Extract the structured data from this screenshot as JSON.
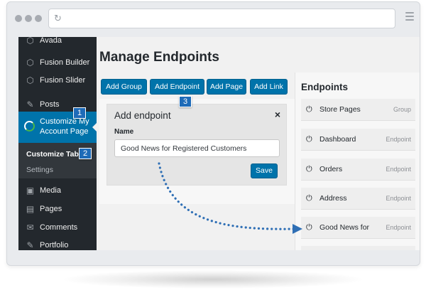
{
  "browser": {
    "window_dot_icons": [
      "window-dot-icon",
      "window-dot-icon",
      "window-dot-icon"
    ],
    "reload_icon": "↻",
    "menu_icon": "hamburger-icon"
  },
  "sidebar": {
    "items": [
      {
        "label": "Avada",
        "icon": "avada-icon",
        "glyph": "⬡"
      },
      {
        "label": "Fusion Builder",
        "icon": "fusion-builder-icon",
        "glyph": "⬡"
      },
      {
        "label": "Fusion Slider",
        "icon": "fusion-slider-icon",
        "glyph": "⬡"
      },
      {
        "label": "Posts",
        "icon": "pin-icon",
        "glyph": "✎"
      }
    ],
    "active": {
      "label": "Customize My Account Page",
      "icon": "customize-icon"
    },
    "submenu": [
      {
        "label": "Customize Tabs",
        "current": true
      },
      {
        "label": "Settings",
        "current": false
      }
    ],
    "lower_items": [
      {
        "label": "Media",
        "icon": "media-icon",
        "glyph": "▣"
      },
      {
        "label": "Pages",
        "icon": "pages-icon",
        "glyph": "▤"
      },
      {
        "label": "Comments",
        "icon": "comments-icon",
        "glyph": "✉"
      },
      {
        "label": "Portfolio",
        "icon": "portfolio-icon",
        "glyph": "✎"
      }
    ],
    "colors": {
      "background": "#23282d",
      "active": "#0073aa",
      "submenu": "#32373c"
    }
  },
  "main": {
    "page_title": "Manage Endpoints",
    "toolbar": {
      "add_group": "Add Group",
      "add_endpoint": "Add Endpoint",
      "add_page": "Add Page",
      "add_link": "Add Link"
    },
    "add_endpoint_form": {
      "title": "Add endpoint",
      "close": "×",
      "name_label": "Name",
      "name_value": "Good News for Registered Customers",
      "save": "Save"
    }
  },
  "endpoints": {
    "title": "Endpoints",
    "items": [
      {
        "name": "Store Pages",
        "type": "Group"
      },
      {
        "name": "Dashboard",
        "type": "Endpoint"
      },
      {
        "name": "Orders",
        "type": "Endpoint"
      },
      {
        "name": "Address",
        "type": "Endpoint"
      },
      {
        "name": "Good News for",
        "type": "Endpoint"
      }
    ],
    "power_glyph": "⏻"
  },
  "callouts": {
    "step_1": "1",
    "step_2": "2",
    "step_3": "3"
  },
  "colors": {
    "accent": "#0073aa",
    "callout": "#1e6bb8",
    "arrow": "#2f6fb5"
  }
}
